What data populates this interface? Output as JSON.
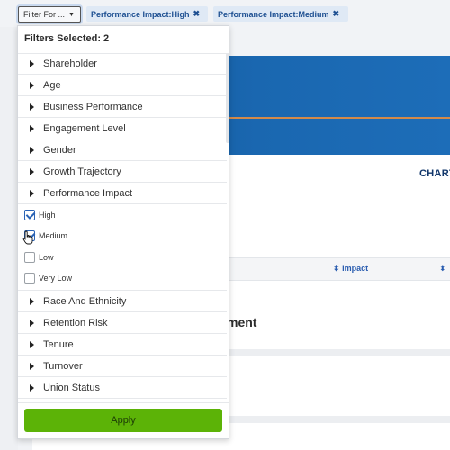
{
  "filter_bar": {
    "filter_button_label": "Filter For ...",
    "chips": [
      {
        "label": "Performance Impact:High"
      },
      {
        "label": "Performance Impact:Medium"
      }
    ]
  },
  "dropdown": {
    "filters_selected": "Filters Selected: 2",
    "categories_top": [
      "Shareholder",
      "Age",
      "Business Performance",
      "Engagement Level",
      "Gender",
      "Growth Trajectory",
      "Performance Impact"
    ],
    "performance_impact_options": [
      {
        "label": "High",
        "checked": true
      },
      {
        "label": "Medium",
        "checked": true
      },
      {
        "label": "Low",
        "checked": false
      },
      {
        "label": "Very Low",
        "checked": false
      }
    ],
    "categories_bottom": [
      "Race And Ethnicity",
      "Retention Risk",
      "Tenure",
      "Turnover",
      "Union Status"
    ],
    "apply_label": "Apply"
  },
  "background": {
    "chart_tab": "CHART",
    "sort_column_impact": "Impact",
    "heading_fragment": "ment"
  },
  "colors": {
    "banner": "#1a67b0",
    "chip_bg": "#dfe9f5",
    "chip_text": "#1d4f91",
    "apply_bg": "#5cb307",
    "checkbox": "#2a63b5"
  }
}
